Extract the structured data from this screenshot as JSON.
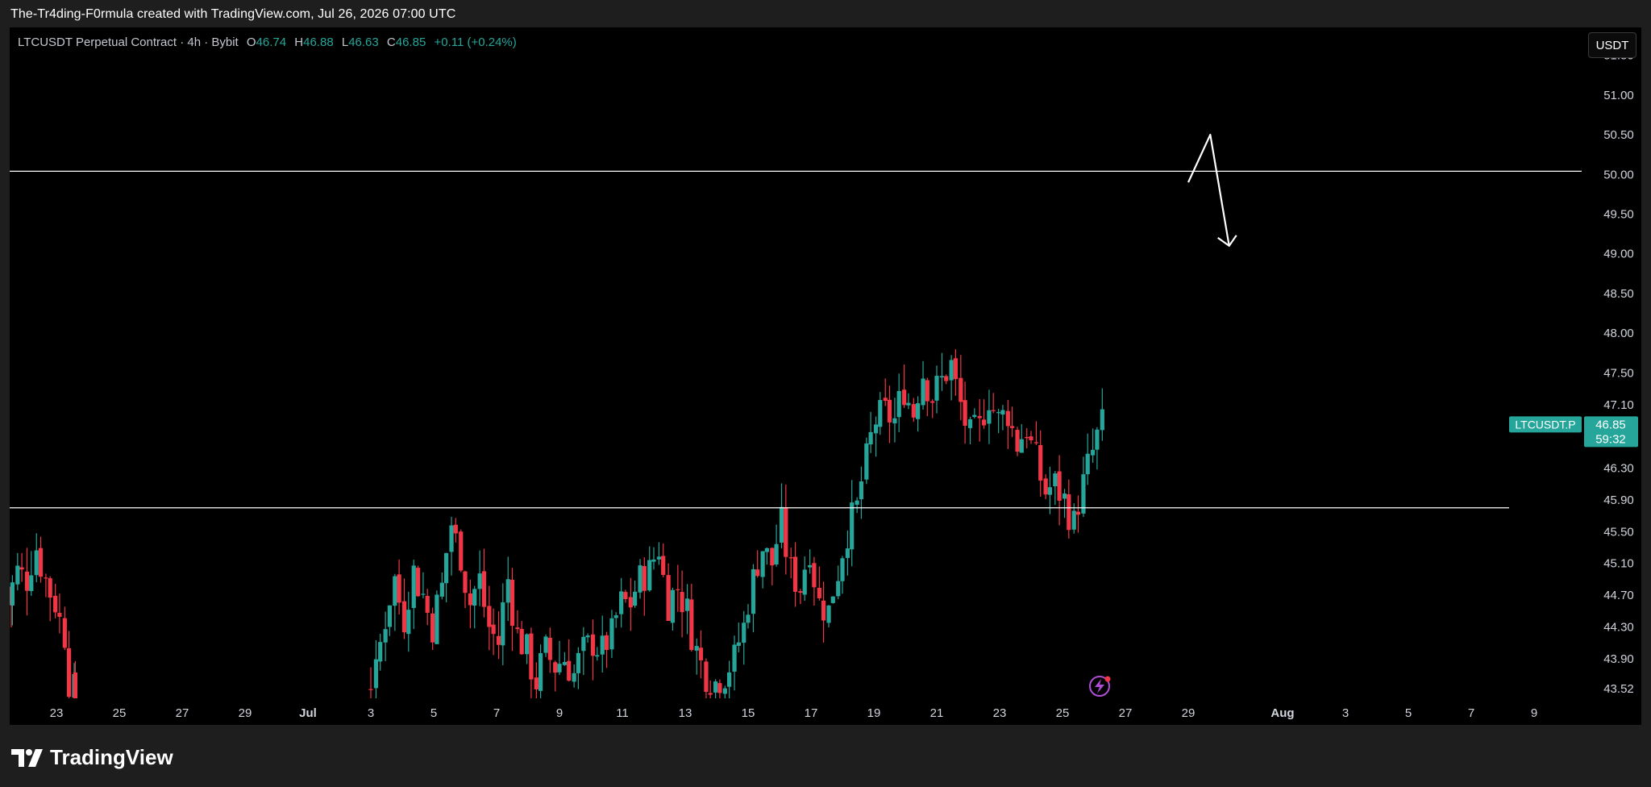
{
  "credit": "The-Tr4ding-F0rmula created with TradingView.com, Jul 26, 2026 07:00 UTC",
  "legend": {
    "symbol": "LTCUSDT Perpetual Contract · 4h · Bybit",
    "open_label": "O",
    "open": "46.74",
    "high_label": "H",
    "high": "46.88",
    "low_label": "L",
    "low": "46.63",
    "close_label": "C",
    "close": "46.85",
    "change": "+0.11 (+0.24%)"
  },
  "unit_button": "USDT",
  "brand": "TradingView",
  "colors": {
    "up": "#26a69a",
    "down": "#f23645",
    "background": "#000000",
    "line": "#ffffff"
  },
  "chart_data": {
    "type": "candlestick",
    "ylim": [
      43.4,
      51.75
    ],
    "y_ticks": [
      51.5,
      51.0,
      50.5,
      50.0,
      49.5,
      49.0,
      48.5,
      48.0,
      47.5,
      47.1,
      46.3,
      45.9,
      45.5,
      45.1,
      44.7,
      44.3,
      43.9,
      43.52
    ],
    "y_tick_labels": [
      "51.50",
      "51.00",
      "50.50",
      "50.00",
      "49.50",
      "49.00",
      "48.50",
      "48.00",
      "47.50",
      "47.10",
      "46.30",
      "45.90",
      "45.50",
      "45.10",
      "44.70",
      "44.30",
      "43.90",
      "43.52"
    ],
    "x_ticks": [
      {
        "label": "23",
        "day": 23
      },
      {
        "label": "25",
        "day": 25
      },
      {
        "label": "27",
        "day": 27
      },
      {
        "label": "29",
        "day": 29
      },
      {
        "label": "Jul",
        "day": 31
      },
      {
        "label": "3",
        "day": 33
      },
      {
        "label": "5",
        "day": 35
      },
      {
        "label": "7",
        "day": 37
      },
      {
        "label": "9",
        "day": 39
      },
      {
        "label": "11",
        "day": 41
      },
      {
        "label": "13",
        "day": 43
      },
      {
        "label": "15",
        "day": 45
      },
      {
        "label": "17",
        "day": 47
      },
      {
        "label": "19",
        "day": 49
      },
      {
        "label": "21",
        "day": 51
      },
      {
        "label": "23",
        "day": 53
      },
      {
        "label": "25",
        "day": 55
      },
      {
        "label": "27",
        "day": 57
      },
      {
        "label": "29",
        "day": 59
      },
      {
        "label": "Aug",
        "day": 62
      },
      {
        "label": "3",
        "day": 64
      },
      {
        "label": "5",
        "day": 66
      },
      {
        "label": "7",
        "day": 68
      },
      {
        "label": "9",
        "day": 70
      }
    ],
    "anchors": [
      [
        21.4,
        45.8
      ],
      [
        21.6,
        44.6
      ],
      [
        21.9,
        45.0
      ],
      [
        22.2,
        44.9
      ],
      [
        22.5,
        45.3
      ],
      [
        22.8,
        44.9
      ],
      [
        23.1,
        44.6
      ],
      [
        23.4,
        44.2
      ],
      [
        23.6,
        43.5
      ],
      [
        23.8,
        43.0
      ],
      [
        33.0,
        43.5
      ],
      [
        33.3,
        43.7
      ],
      [
        33.6,
        44.4
      ],
      [
        33.9,
        44.9
      ],
      [
        34.2,
        44.4
      ],
      [
        34.5,
        45.0
      ],
      [
        34.8,
        44.7
      ],
      [
        35.1,
        44.3
      ],
      [
        35.4,
        44.8
      ],
      [
        35.7,
        45.6
      ],
      [
        36.0,
        45.2
      ],
      [
        36.3,
        44.6
      ],
      [
        36.6,
        44.9
      ],
      [
        36.9,
        44.3
      ],
      [
        37.2,
        44.1
      ],
      [
        37.5,
        44.9
      ],
      [
        37.8,
        44.2
      ],
      [
        38.1,
        44.0
      ],
      [
        38.4,
        43.6
      ],
      [
        38.7,
        44.0
      ],
      [
        39.0,
        43.8
      ],
      [
        39.3,
        43.9
      ],
      [
        39.6,
        43.7
      ],
      [
        39.9,
        44.0
      ],
      [
        40.2,
        44.1
      ],
      [
        40.5,
        44.0
      ],
      [
        40.8,
        44.2
      ],
      [
        41.1,
        44.6
      ],
      [
        41.4,
        44.6
      ],
      [
        41.7,
        44.9
      ],
      [
        42.0,
        45.0
      ],
      [
        42.3,
        45.3
      ],
      [
        42.6,
        44.6
      ],
      [
        42.9,
        44.8
      ],
      [
        43.2,
        44.5
      ],
      [
        43.5,
        44.0
      ],
      [
        43.8,
        43.7
      ],
      [
        44.1,
        43.6
      ],
      [
        44.4,
        43.7
      ],
      [
        44.7,
        43.9
      ],
      [
        45.0,
        44.3
      ],
      [
        45.3,
        44.9
      ],
      [
        45.6,
        45.3
      ],
      [
        45.9,
        45.1
      ],
      [
        46.2,
        45.6
      ],
      [
        46.5,
        45.0
      ],
      [
        46.8,
        44.8
      ],
      [
        47.1,
        45.3
      ],
      [
        47.4,
        44.6
      ],
      [
        47.7,
        44.5
      ],
      [
        48.0,
        45.0
      ],
      [
        48.3,
        45.5
      ],
      [
        48.6,
        45.8
      ],
      [
        48.9,
        46.4
      ],
      [
        49.2,
        46.9
      ],
      [
        49.5,
        47.0
      ],
      [
        49.8,
        46.9
      ],
      [
        50.1,
        47.3
      ],
      [
        50.4,
        47.0
      ],
      [
        50.7,
        47.5
      ],
      [
        51.0,
        47.2
      ],
      [
        51.3,
        47.4
      ],
      [
        51.6,
        47.6
      ],
      [
        51.9,
        47.1
      ],
      [
        52.2,
        46.7
      ],
      [
        52.5,
        46.8
      ],
      [
        52.8,
        47.2
      ],
      [
        53.1,
        46.9
      ],
      [
        53.4,
        47.0
      ],
      [
        53.7,
        46.6
      ],
      [
        54.0,
        46.8
      ],
      [
        54.3,
        46.4
      ],
      [
        54.6,
        46.0
      ],
      [
        54.9,
        46.1
      ],
      [
        55.2,
        45.9
      ],
      [
        55.5,
        45.6
      ],
      [
        55.8,
        46.1
      ],
      [
        56.1,
        46.5
      ],
      [
        56.4,
        46.85
      ]
    ],
    "levels": [
      50.04,
      45.8
    ],
    "last_price": {
      "symbol_label": "LTCUSDT.P",
      "price": "46.85",
      "countdown": "59:32"
    },
    "arrow": [
      [
        59.0,
        49.9
      ],
      [
        59.7,
        50.5
      ],
      [
        60.3,
        49.1
      ]
    ]
  }
}
